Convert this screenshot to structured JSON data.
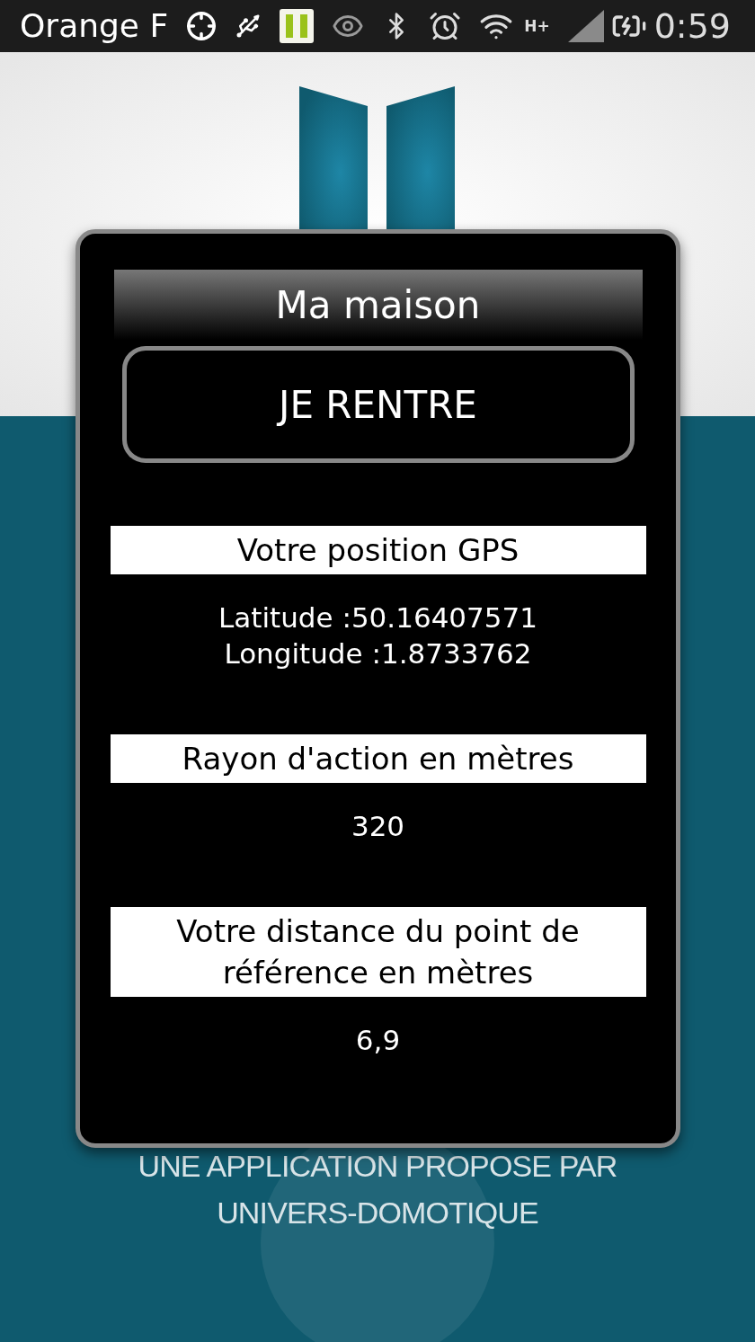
{
  "status_bar": {
    "carrier": "Orange F",
    "network_type": "H+",
    "time": "0:59"
  },
  "background": {
    "credit_lines": [
      "UNE APPLICATION PROPOSE PAR",
      "UNIVERS-DOMOTIQUE"
    ]
  },
  "dialog": {
    "title": "Ma maison",
    "action_button": "JE RENTRE",
    "sections": [
      {
        "heading": "Votre position GPS",
        "lines": [
          "Latitude :50.16407571",
          "Longitude :1.8733762"
        ]
      },
      {
        "heading": "Rayon d'action en mètres",
        "lines": [
          "320"
        ]
      },
      {
        "heading": "Votre distance du point de référence en mètres",
        "lines": [
          "6,9"
        ]
      }
    ]
  }
}
